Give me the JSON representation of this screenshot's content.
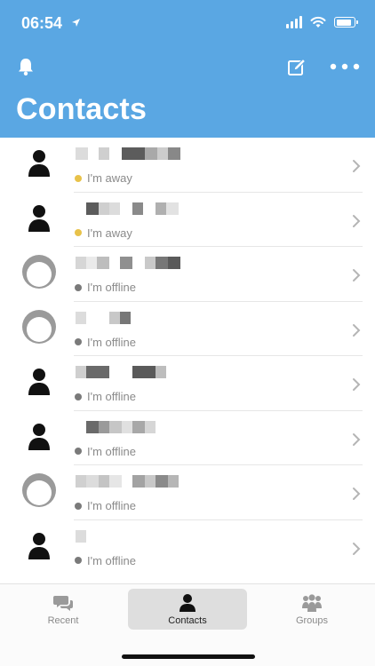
{
  "status_bar": {
    "time": "06:54"
  },
  "header": {
    "title": "Contacts"
  },
  "contacts": [
    {
      "status": "I'm away",
      "presence": "away",
      "avatar": "person"
    },
    {
      "status": "I'm away",
      "presence": "away",
      "avatar": "person"
    },
    {
      "status": "I'm offline",
      "presence": "offline",
      "avatar": "ring"
    },
    {
      "status": "I'm offline",
      "presence": "offline",
      "avatar": "ring"
    },
    {
      "status": "I'm offline",
      "presence": "offline",
      "avatar": "person"
    },
    {
      "status": "I'm offline",
      "presence": "offline",
      "avatar": "person"
    },
    {
      "status": "I'm offline",
      "presence": "offline",
      "avatar": "ring"
    },
    {
      "status": "I'm offline",
      "presence": "offline",
      "avatar": "person"
    }
  ],
  "tabs": [
    {
      "label": "Recent",
      "icon": "chat-bubbles-icon",
      "active": false
    },
    {
      "label": "Contacts",
      "icon": "person-icon",
      "active": true
    },
    {
      "label": "Groups",
      "icon": "group-icon",
      "active": false
    }
  ],
  "colors": {
    "header": "#5aa7e3",
    "away": "#e8c24a",
    "offline": "#7a7a7a"
  }
}
